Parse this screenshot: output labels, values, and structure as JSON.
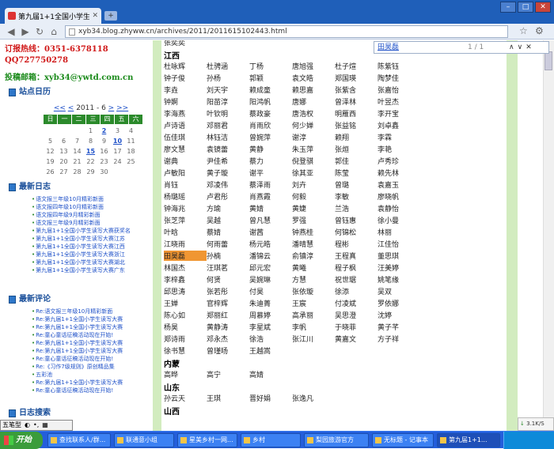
{
  "browser": {
    "tab_title": "第九届1+1全国小学生读写大",
    "url": "xyb34.blog.zhyww.cn/archives/2011/2011615102443.html",
    "find_query": "田昊磊",
    "find_count": "1 / 1",
    "find_ctl": [
      "∧",
      "∨",
      "✕"
    ]
  },
  "left": {
    "contacts": [
      {
        "text": "订报热线：0351-6378118",
        "kind": "phone"
      },
      {
        "text": "QQ727750278",
        "kind": "phone"
      },
      {
        "text": "投稿邮箱：xyb34@ywtd.com.cn",
        "kind": "mail"
      }
    ],
    "calendar_title": "站点日历",
    "calendar_nav": {
      "prevprev": "<<",
      "prev": "<",
      "label": " 2011 - 6 ",
      "next": ">",
      "nextnext": ">>"
    },
    "weekdays": [
      "日",
      "一",
      "二",
      "三",
      "四",
      "五",
      "六"
    ],
    "days": [
      "",
      "",
      "",
      "1",
      "2",
      "3",
      "4",
      "5",
      "6",
      "7",
      "8",
      "9",
      "10",
      "11",
      "12",
      "13",
      "14",
      "15",
      "16",
      "17",
      "18",
      "19",
      "20",
      "21",
      "22",
      "23",
      "24",
      "25",
      "26",
      "27",
      "28",
      "29",
      "30",
      "",
      ""
    ],
    "linked_days": [
      "2",
      "10",
      "15"
    ],
    "latest_logs_title": "最新日志",
    "latest_logs": [
      "语文报三年级10月精彩新面",
      "语文报四年级10月精彩新面",
      "语文报四年级9月精彩新面",
      "语文报三年级9月精彩新面",
      "第九届1+1全国小学生读写大赛获奖名",
      "第九届1+1全国小学生读写大赛江苏",
      "第九届1+1全国小学生读写大赛江西",
      "第九届1+1全国小学生读写大赛浙江",
      "第九届1+1全国小学生读写大赛湖北",
      "第九届1+1全国小学生读写大赛广东"
    ],
    "latest_comments_title": "最新评论",
    "latest_comments": [
      "Re:语文报三年级10月精彩新面",
      "Re:第九届1+1全国小学生读写大赛",
      "Re:第九届1+1全国小学生读写大赛",
      "Re:童心童话征稿活动现在开始!",
      "Re:第九届1+1全国小学生读写大赛",
      "Re:第九届1+1全国小学生读写大赛",
      "Re:童心童话征稿活动现在开始!",
      "Re:《习作7级规则》原创精品集",
      "五彩池",
      "Re:第九届1+1全国小学生读写大赛",
      "Re:童心童话征稿活动现在开始!"
    ],
    "search_title": "日志搜索"
  },
  "names": {
    "rows": [
      [
        "张奕奕"
      ],
      [
        "__江西"
      ],
      [
        "杜咏辉",
        "杜骋涵",
        "丁杨",
        "唐旭强",
        "杜子煊",
        "陈紫钰"
      ],
      [
        "钟子俊",
        "孙杨",
        "郭颖",
        "袁文皓",
        "郑国瑛",
        "陶梦佳"
      ],
      [
        "李垚",
        "刘天宇",
        "赖成童",
        "赖思嘉",
        "张紫含",
        "张嘉怡"
      ],
      [
        "钟婀",
        "阳苗淳",
        "阳鸿帆",
        "唐娜",
        "曾泽林",
        "叶昱杰"
      ],
      [
        "李海燕",
        "叶钦明",
        "蔡政豪",
        "唐浩权",
        "明雁西",
        "李开宝"
      ],
      [
        "卢诗语",
        "邓丽君",
        "肖雨欣",
        "何少婵",
        "张益铭",
        "刘卓鑫"
      ],
      [
        "伍佳琪",
        "林钰洁",
        "曾婉萍",
        "谢淳",
        "赖翔",
        "李霖"
      ],
      [
        "廖文慧",
        "袁镜蕾",
        "黄静",
        "朱玉萍",
        "张烜",
        "李艳"
      ],
      [
        "谢典",
        "尹佳希",
        "蔡力",
        "倪登骐",
        "郭佳",
        "卢秀珍"
      ],
      [
        "卢敏阳",
        "黄子璇",
        "谢平",
        "徐其亚",
        "陈莹",
        "赖先林"
      ],
      [
        "肖钰",
        "邓凌伟",
        "蔡泽雨",
        "刘卉",
        "曾璐",
        "袁嘉玉"
      ],
      [
        "杨璐瑶",
        "卢君彤",
        "肖燕霞",
        "何毅",
        "李敏",
        "廖晓帆"
      ],
      [
        "钟海兆",
        "方瑜",
        "黄婧",
        "黄婕",
        "兰浩",
        "袁静怡"
      ],
      [
        "张芝萍",
        "吴越",
        "曾凡慧",
        "罗强",
        "曾钰惠",
        "徐小曼"
      ],
      [
        "叶晗",
        "蔡婧",
        "谢茜",
        "钟燕桂",
        "何锦松",
        "林丽"
      ],
      [
        "江晓雨",
        "何雨蕾",
        "杨元皓",
        "潘晴慧",
        "程彬",
        "江佳怡"
      ],
      [
        "*田昊磊",
        "孙楠",
        "潘锦云",
        "俞镇淳",
        "王程真",
        "董思琪"
      ],
      [
        "林国杰",
        "汪琪茗",
        "邱元宏",
        "黄曦",
        "程子枫",
        "汪美婷"
      ],
      [
        "李梓鑫",
        "何贤",
        "吴婉琳",
        "方慧",
        "祝世琚",
        "姚笔缘"
      ],
      [
        "邱思涛",
        "张若彤",
        "付昊",
        "张依璇",
        "徐添",
        "吴双"
      ],
      [
        "王婵",
        "官梓辉",
        "朱迪菁",
        "王宸",
        "付凌斌",
        "罗依娜"
      ],
      [
        "陈心如",
        "郑丽红",
        "周慕婷",
        "高承丽",
        "吴思澄",
        "沈婷"
      ],
      [
        "杨昊",
        "黄静涛",
        "李星斌",
        "李帆",
        "于晓菲",
        "黄子芊"
      ],
      [
        "郑诗雨",
        "邓永杰",
        "徐浩",
        "张江川",
        "黄嘉文",
        "方子祥"
      ],
      [
        "徐书慧",
        "曾瑾旸",
        "王越嵩"
      ],
      [
        "__内蒙"
      ],
      [
        "高晔",
        "高宁",
        "高婧"
      ],
      [
        "__山东"
      ],
      [
        "孙云天",
        "王琪",
        "晋好娟",
        "张逸凡"
      ],
      [
        "__山西"
      ]
    ]
  },
  "taskbar": {
    "start": "开始",
    "tasks": [
      "查找联系人/群...",
      "联通意小组",
      "星美乡村一网...",
      "乡村",
      "梨园旅游官方",
      "无标题 - 记事本",
      "第九届1+1..."
    ],
    "tray_time": ""
  },
  "ime_label": "五笔型",
  "download": "3.1K/S"
}
